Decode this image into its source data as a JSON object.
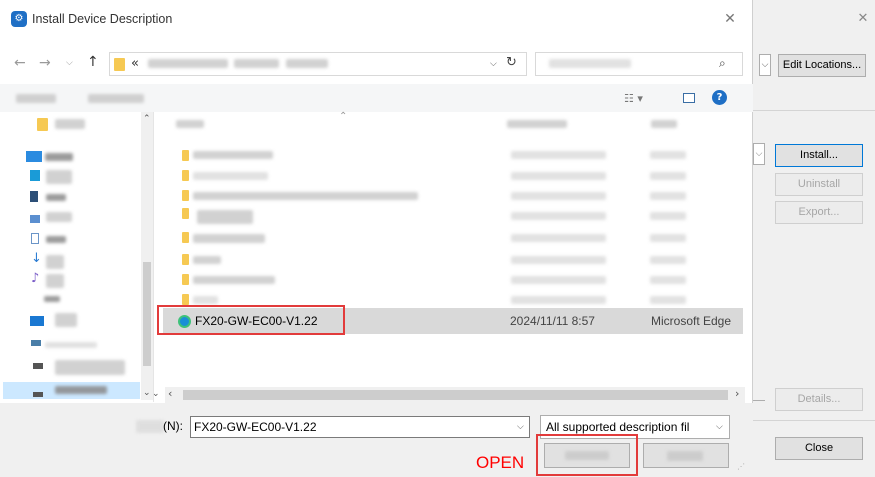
{
  "dialog": {
    "title": "Install Device Description",
    "address_prefix": "«",
    "selected_file": {
      "name": "FX20-GW-EC00-V1.22",
      "date": "2024/11/11 8:57",
      "type": "Microsoft Edge"
    },
    "filename_label": "(N):",
    "filename_value": "FX20-GW-EC00-V1.22",
    "filter_value": "All supported description fil",
    "annotation_label": "OPEN"
  },
  "background_window": {
    "buttons": {
      "edit_locations": "Edit Locations...",
      "install": "Install...",
      "uninstall": "Uninstall",
      "export": "Export...",
      "details": "Details...",
      "close": "Close"
    }
  },
  "icons": {
    "app": "app-icon",
    "edge": "edge-icon",
    "refresh": "refresh-icon",
    "search": "search-icon",
    "help": "help-icon"
  },
  "colors": {
    "highlight": "#e23b3b",
    "selection": "#d9d9d9",
    "accent": "#0078d7"
  }
}
